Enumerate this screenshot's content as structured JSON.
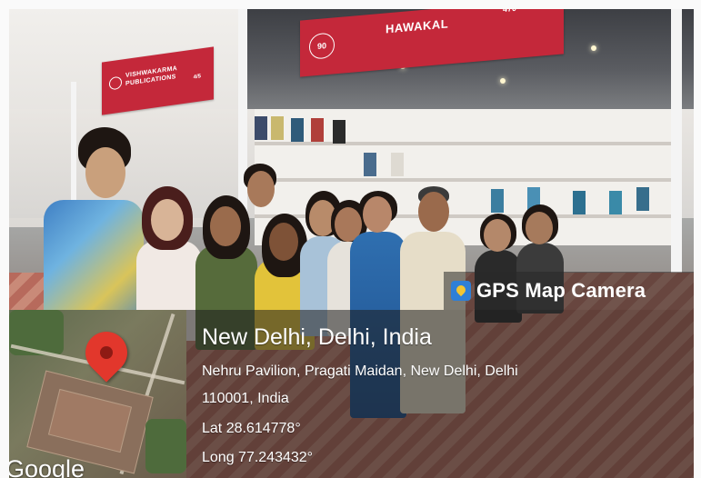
{
  "banners": {
    "left": {
      "text": "VISHWAKARMA PUBLICATIONS",
      "number": "4/5"
    },
    "top": {
      "text": "HAWAKAL",
      "number": "470",
      "logo": "90"
    }
  },
  "gps_overlay": {
    "app_name": "GPS Map Camera",
    "app_icon": "map-pin-icon",
    "city": "New Delhi, Delhi, India",
    "address_line1": "Nehru Pavilion, Pragati Maidan, New Delhi, Delhi",
    "address_line2": "110001, India",
    "latitude": "Lat 28.614778°",
    "longitude": "Long 77.243432°",
    "map_attribution": "Google",
    "pin_color": "#e2372c"
  }
}
